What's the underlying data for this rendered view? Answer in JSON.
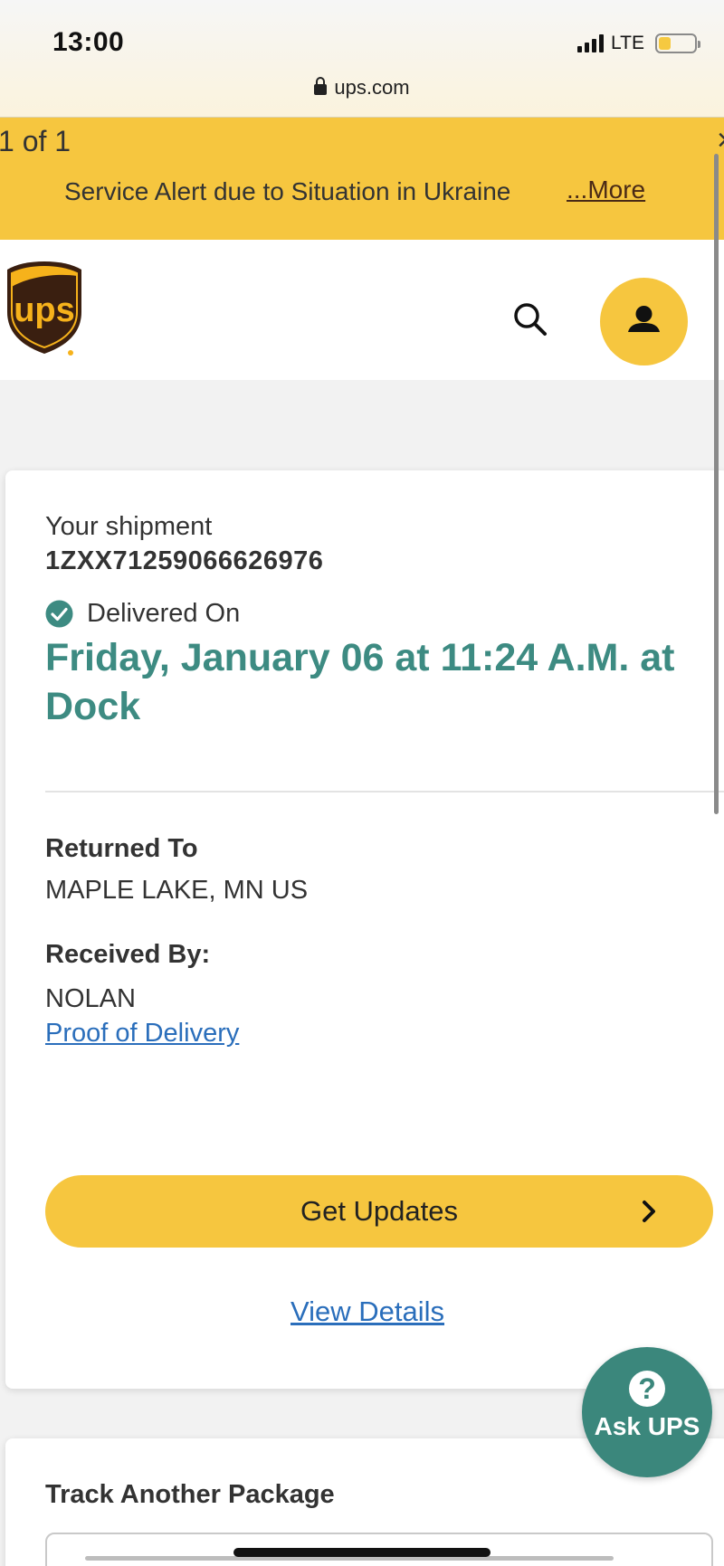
{
  "status_bar": {
    "time": "13:00",
    "network": "LTE"
  },
  "browser": {
    "url": "ups.com"
  },
  "alert": {
    "count": "1 of 1",
    "message": "Service Alert due to Situation in Ukraine",
    "more_label": "...More"
  },
  "header": {
    "logo_text": "ups"
  },
  "shipment": {
    "label": "Your shipment",
    "tracking_number": "1ZXX71259066626976",
    "status_label": "Delivered On",
    "delivered_datetime": "Friday, January 06 at 11:24 A.M. at Dock",
    "returned_to_label": "Returned To",
    "returned_to_value": "MAPLE LAKE, MN US",
    "received_by_label": "Received By:",
    "received_by_value": "NOLAN",
    "proof_link": "Proof of Delivery",
    "get_updates_label": "Get Updates",
    "view_details_label": "View Details"
  },
  "ask_ups": {
    "label": "Ask UPS"
  },
  "track_another": {
    "title": "Track Another Package"
  },
  "colors": {
    "brand_yellow": "#f6c63f",
    "brand_brown": "#4a2a16",
    "status_green": "#3d8b82",
    "link_blue": "#2a6ebb"
  }
}
